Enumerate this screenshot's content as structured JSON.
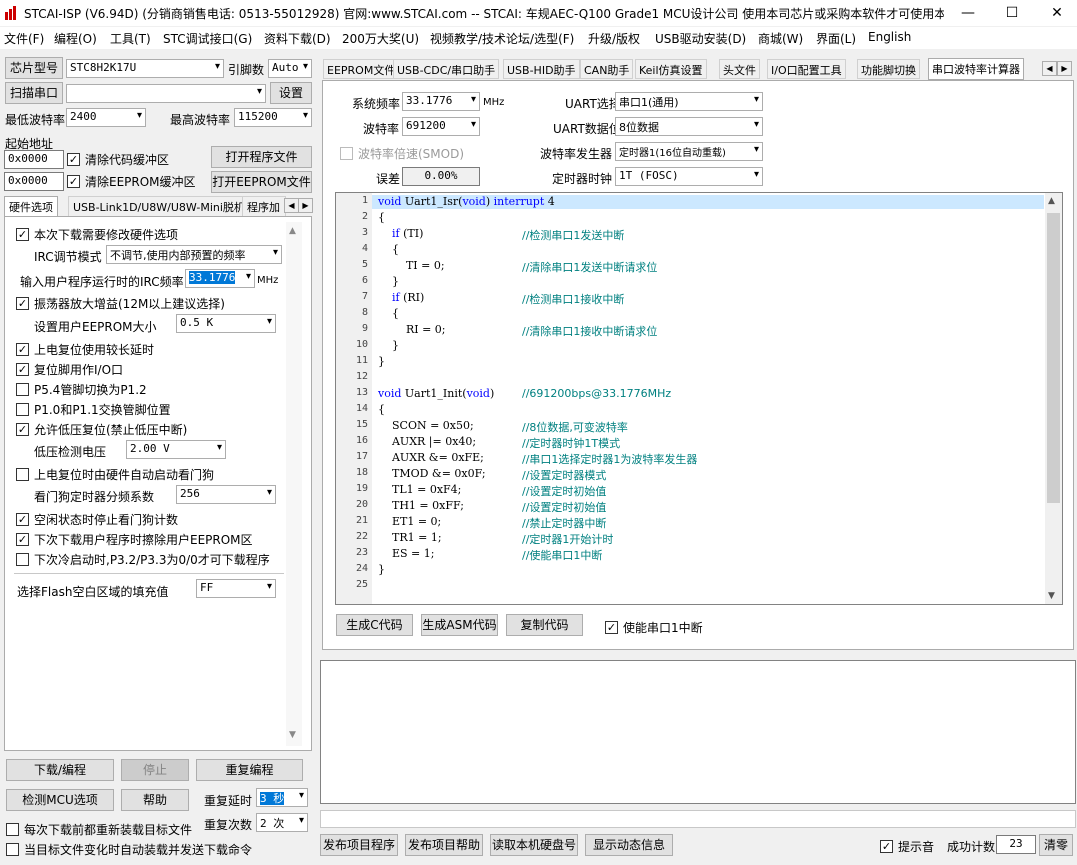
{
  "window": {
    "title": "STCAI-ISP (V6.94D) (分销商销售电话: 0513-55012928) 官网:www.STCAI.com  -- STCAI: 车规AEC-Q100 Grade1 MCU设计公司 使用本司芯片或采购本软件才可使用本...",
    "min": "—",
    "max": "☐",
    "close": "✕"
  },
  "menu": [
    "文件(F)",
    "编程(O)",
    "工具(T)",
    "STC调试接口(G)",
    "资料下载(D)",
    "200万大奖(U)",
    "视频教学/技术论坛/选型(F)",
    "升级/版权",
    "USB驱动安装(D)",
    "商城(W)",
    "界面(L)",
    "English"
  ],
  "left": {
    "chip_btn": "芯片型号",
    "chip_value": "STC8H2K17U",
    "pins_label": "引脚数",
    "pins_value": "Auto",
    "scan_btn": "扫描串口",
    "port_value": "",
    "settings_btn": "设置",
    "min_baud_label": "最低波特率",
    "min_baud_value": "2400",
    "max_baud_label": "最高波特率",
    "max_baud_value": "115200",
    "start_addr_label": "起始地址",
    "addr1": "0x0000",
    "clear_code_label": "清除代码缓冲区",
    "open_prog_btn": "打开程序文件",
    "addr2": "0x0000",
    "clear_eeprom_label": "清除EEPROM缓冲区",
    "open_eeprom_btn": "打开EEPROM文件",
    "tabs": [
      "硬件选项",
      "USB-Link1D/U8W/U8W-Mini脱机",
      "程序加"
    ],
    "hw": {
      "opt1": "本次下载需要修改硬件选项",
      "irc_mode_label": "IRC调节模式",
      "irc_mode_value": "不调节,使用内部预置的频率",
      "irc_freq_label": "输入用户程序运行时的IRC频率",
      "irc_freq_value": "33.1776",
      "irc_unit": "MHz",
      "osc_gain": "振荡器放大增益(12M以上建议选择)",
      "eeprom_size_label": "设置用户EEPROM大小",
      "eeprom_size_value": "0.5 K",
      "por_delay": "上电复位使用较长延时",
      "reset_io": "复位脚用作I/O口",
      "p54": "P5.4管脚切换为P1.2",
      "p10": "P1.0和P1.1交换管脚位置",
      "lvr": "允许低压复位(禁止低压中断)",
      "lvd_label": "低压检测电压",
      "lvd_value": "2.00 V",
      "wdt_auto": "上电复位时由硬件自动启动看门狗",
      "wdt_div_label": "看门狗定时器分频系数",
      "wdt_div_value": "256",
      "idle_wdt": "空闲状态时停止看门狗计数",
      "erase_eeprom": "下次下载用户程序时擦除用户EEPROM区",
      "cold_boot": "下次冷启动时,P3.2/P3.3为0/0才可下载程序",
      "flash_fill_label": "选择Flash空白区域的填充值",
      "flash_fill_value": "FF"
    },
    "download_btn": "下载/编程",
    "stop_btn": "停止",
    "reprogram_btn": "重复编程",
    "detect_btn": "检测MCU选项",
    "help_btn": "帮助",
    "repeat_delay_label": "重复延时",
    "repeat_delay_value": "3 秒",
    "repeat_count_label": "重复次数",
    "repeat_count_value": "2 次",
    "reload_label": "每次下载前都重新装载目标文件",
    "auto_label": "当目标文件变化时自动装载并发送下载命令"
  },
  "right": {
    "tabs": [
      "EEPROM文件",
      "USB-CDC/串口助手",
      "USB-HID助手",
      "CAN助手",
      "Keil仿真设置",
      "头文件",
      "I/O口配置工具",
      "功能脚切换",
      "串口波特率计算器"
    ],
    "sys_freq_label": "系统频率",
    "sys_freq_value": "33.1776",
    "sys_freq_unit": "MHz",
    "uart_sel_label": "UART选择",
    "uart_sel_value": "串口1(通用)",
    "baud_label": "波特率",
    "baud_value": "691200",
    "uart_bits_label": "UART数据位",
    "uart_bits_value": "8位数据",
    "smod_label": "波特率倍速(SMOD)",
    "gen_label": "波特率发生器",
    "gen_value": "定时器1(16位自动重载)",
    "err_label": "误差",
    "err_value": "0.00%",
    "clk_label": "定时器时钟",
    "clk_value": "1T  (FOSC)",
    "code_lines": [
      {
        "n": "1",
        "code": "void Uart1_Isr(void) interrupt 4",
        "cm": ""
      },
      {
        "n": "2",
        "code": "{",
        "cm": ""
      },
      {
        "n": "3",
        "code": "    if (TI)",
        "cm": "//检测串口1发送中断"
      },
      {
        "n": "4",
        "code": "    {",
        "cm": ""
      },
      {
        "n": "5",
        "code": "        TI = 0;",
        "cm": "//清除串口1发送中断请求位"
      },
      {
        "n": "6",
        "code": "    }",
        "cm": ""
      },
      {
        "n": "7",
        "code": "    if (RI)",
        "cm": "//检测串口1接收中断"
      },
      {
        "n": "8",
        "code": "    {",
        "cm": ""
      },
      {
        "n": "9",
        "code": "        RI = 0;",
        "cm": "//清除串口1接收中断请求位"
      },
      {
        "n": "10",
        "code": "    }",
        "cm": ""
      },
      {
        "n": "11",
        "code": "}",
        "cm": ""
      },
      {
        "n": "12",
        "code": "",
        "cm": ""
      },
      {
        "n": "13",
        "code": "void Uart1_Init(void)",
        "cm": "//691200bps@33.1776MHz"
      },
      {
        "n": "14",
        "code": "{",
        "cm": ""
      },
      {
        "n": "15",
        "code": "    SCON = 0x50;",
        "cm": "//8位数据,可变波特率"
      },
      {
        "n": "16",
        "code": "    AUXR |= 0x40;",
        "cm": "//定时器时钟1T模式"
      },
      {
        "n": "17",
        "code": "    AUXR &= 0xFE;",
        "cm": "//串口1选择定时器1为波特率发生器"
      },
      {
        "n": "18",
        "code": "    TMOD &= 0x0F;",
        "cm": "//设置定时器模式"
      },
      {
        "n": "19",
        "code": "    TL1 = 0xF4;",
        "cm": "//设置定时初始值"
      },
      {
        "n": "20",
        "code": "    TH1 = 0xFF;",
        "cm": "//设置定时初始值"
      },
      {
        "n": "21",
        "code": "    ET1 = 0;",
        "cm": "//禁止定时器中断"
      },
      {
        "n": "22",
        "code": "    TR1 = 1;",
        "cm": "//定时器1开始计时"
      },
      {
        "n": "23",
        "code": "    ES = 1;",
        "cm": "//使能串口1中断"
      },
      {
        "n": "24",
        "code": "}",
        "cm": ""
      },
      {
        "n": "25",
        "code": "",
        "cm": ""
      }
    ],
    "gen_c_btn": "生成C代码",
    "gen_asm_btn": "生成ASM代码",
    "copy_btn": "复制代码",
    "enable_int_label": "使能串口1中断",
    "pub_prog_btn": "发布项目程序",
    "pub_help_btn": "发布项目帮助",
    "read_disk_btn": "读取本机硬盘号",
    "dyn_info_btn": "显示动态信息",
    "beep_label": "提示音",
    "count_label": "成功计数",
    "count_value": "23",
    "clear_btn": "清零"
  },
  "colors": {
    "keyword": "#0000ff",
    "comment": "#008080",
    "highlight": "#cce8ff"
  }
}
